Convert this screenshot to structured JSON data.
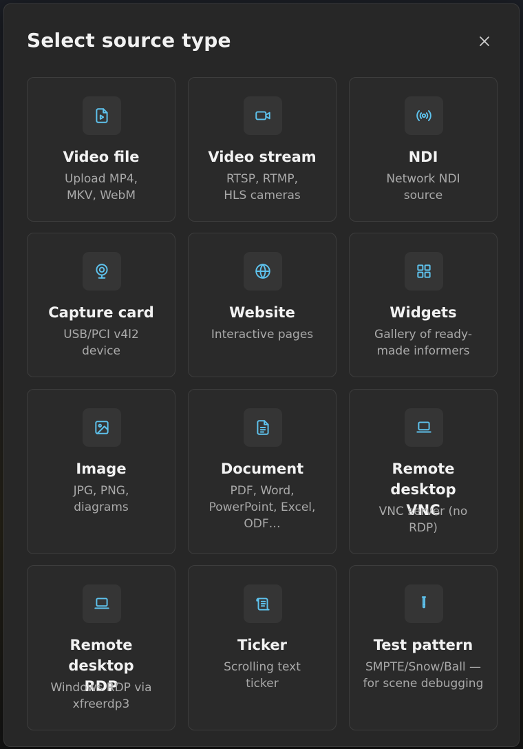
{
  "dialog": {
    "title": "Select source type",
    "close_label": "×"
  },
  "accent_color": "#5ec3ee",
  "sources": [
    {
      "title": "Video file",
      "description": "Upload MP4, MKV, WebM",
      "icon": "video-file-icon"
    },
    {
      "title": "Video stream",
      "description": "RTSP, RTMP, HLS cameras",
      "icon": "video-camera-icon"
    },
    {
      "title": "NDI",
      "description": "Network NDI source",
      "icon": "broadcast-icon"
    },
    {
      "title": "Capture card",
      "description": "USB/PCI v4l2 device",
      "icon": "webcam-icon"
    },
    {
      "title": "Website",
      "description": "Interactive pages",
      "icon": "globe-icon"
    },
    {
      "title": "Widgets",
      "description": "Gallery of ready-made informers",
      "icon": "grid-icon"
    },
    {
      "title": "Image",
      "description": "JPG, PNG, diagrams",
      "icon": "image-icon"
    },
    {
      "title": "Document",
      "description": "PDF, Word, PowerPoint, Excel, ODF…",
      "icon": "document-icon"
    },
    {
      "title": "Remote desktop VNC",
      "description": "VNC server (no RDP)",
      "icon": "laptop-icon"
    },
    {
      "title": "Remote desktop RDP",
      "description": "Windows RDP via xfreerdp3",
      "icon": "laptop-icon"
    },
    {
      "title": "Ticker",
      "description": "Scrolling text ticker",
      "icon": "scroll-icon"
    },
    {
      "title": "Test pattern",
      "description": "SMPTE/Snow/Ball — for scene debugging",
      "icon": "test-tube-icon"
    }
  ]
}
